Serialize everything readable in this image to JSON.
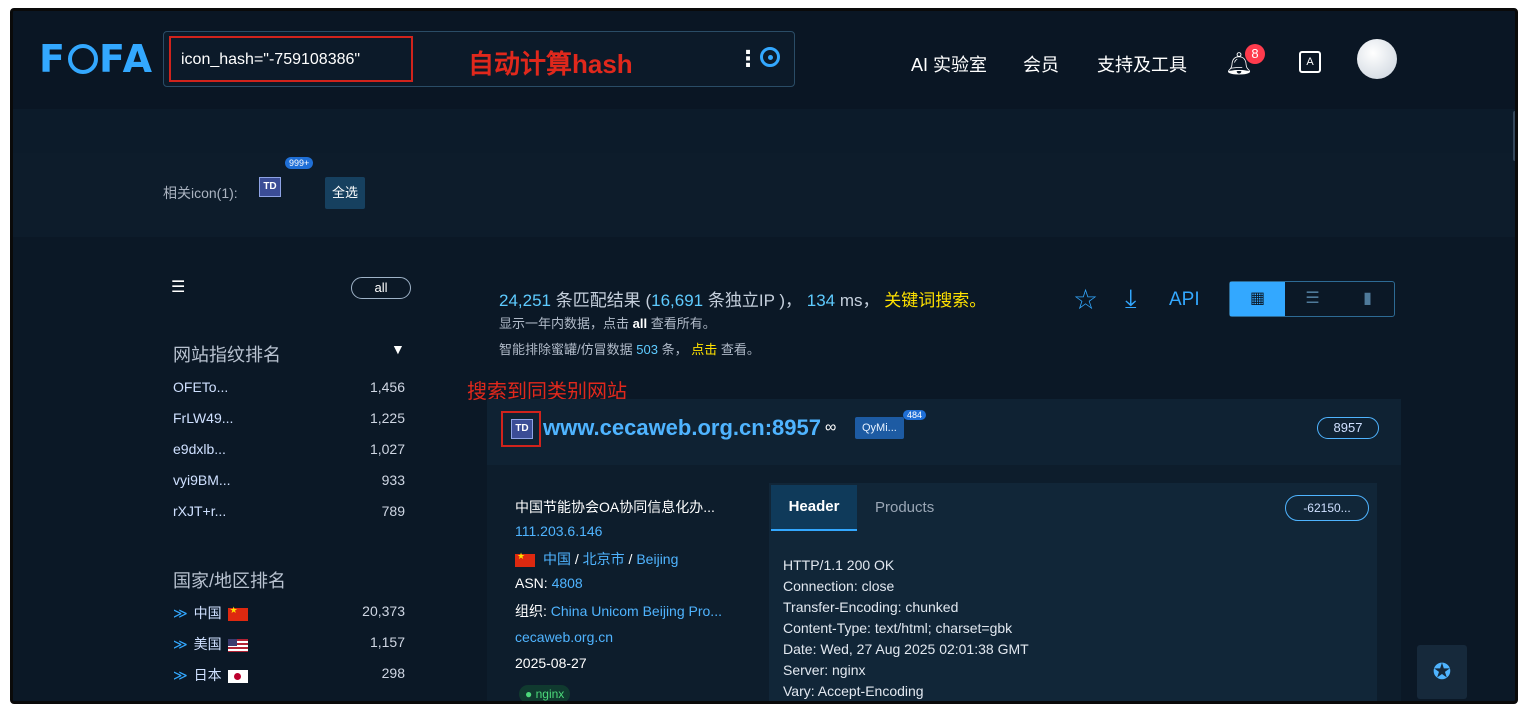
{
  "header": {
    "logo_prefix": "F",
    "logo_suffix": "FA",
    "search_value": "icon_hash=\"-759108386\"",
    "annotation": "自动计算hash",
    "nav": [
      "AI 实验室",
      "会员",
      "支持及工具"
    ],
    "notification_count": "8"
  },
  "related": {
    "label": "相关icon(1):",
    "icon_text": "TD",
    "count_badge": "999+",
    "select_all": "全选"
  },
  "sidebar": {
    "all_label": "all",
    "fingerprint_title": "网站指纹排名",
    "fingerprints": [
      {
        "name": "OFETo...",
        "value": "1,456"
      },
      {
        "name": "FrLW49...",
        "value": "1,225"
      },
      {
        "name": "e9dxlb...",
        "value": "1,027"
      },
      {
        "name": "vyi9BM...",
        "value": "933"
      },
      {
        "name": "rXJT+r...",
        "value": "789"
      }
    ],
    "country_title": "国家/地区排名",
    "countries": [
      {
        "name": "中国",
        "value": "20,373",
        "flag": "cn"
      },
      {
        "name": "美国",
        "value": "1,157",
        "flag": "us"
      },
      {
        "name": "日本",
        "value": "298",
        "flag": "jp"
      }
    ]
  },
  "results": {
    "total": "24,251",
    "total_label": "条匹配结果 (",
    "ips": "16,691",
    "ips_label": "条独立IP )，",
    "ms": "134",
    "ms_label": "ms，",
    "keyword_search": "关键词搜索。",
    "sub1_prefix": "显示一年内数据，点击",
    "sub1_all": "all",
    "sub1_suffix": "查看所有。",
    "sub2_prefix": "智能排除蜜罐/仿冒数据",
    "sub2_count": "503",
    "sub2_mid": "条，",
    "sub2_click": "点击",
    "sub2_suffix": "查看。",
    "api_label": "API"
  },
  "annotation_site": "搜索到同类别网站",
  "card": {
    "icon_text": "TD",
    "host": "www.cecaweb.org.cn:8957",
    "tag": "QyMi...",
    "tag_count": "484",
    "port": "8957",
    "title": "中国节能协会OA协同信息化办...",
    "ip": "111.203.6.146",
    "country": "中国",
    "city": "北京市",
    "city_en": "Beijing",
    "asn_label": "ASN:",
    "asn": "4808",
    "org_label": "组织:",
    "org": "China Unicom Beijing Pro...",
    "domain": "cecaweb.org.cn",
    "date": "2025-08-27",
    "server_tag": "nginx",
    "tab_header": "Header",
    "tab_products": "Products",
    "hash_pill": "-62150...",
    "headers": [
      "HTTP/1.1 200 OK",
      "Connection: close",
      "Transfer-Encoding: chunked",
      "Content-Type: text/html; charset=gbk",
      "Date: Wed, 27 Aug 2025 02:01:38 GMT",
      "Server: nginx",
      "Vary: Accept-Encoding"
    ]
  }
}
